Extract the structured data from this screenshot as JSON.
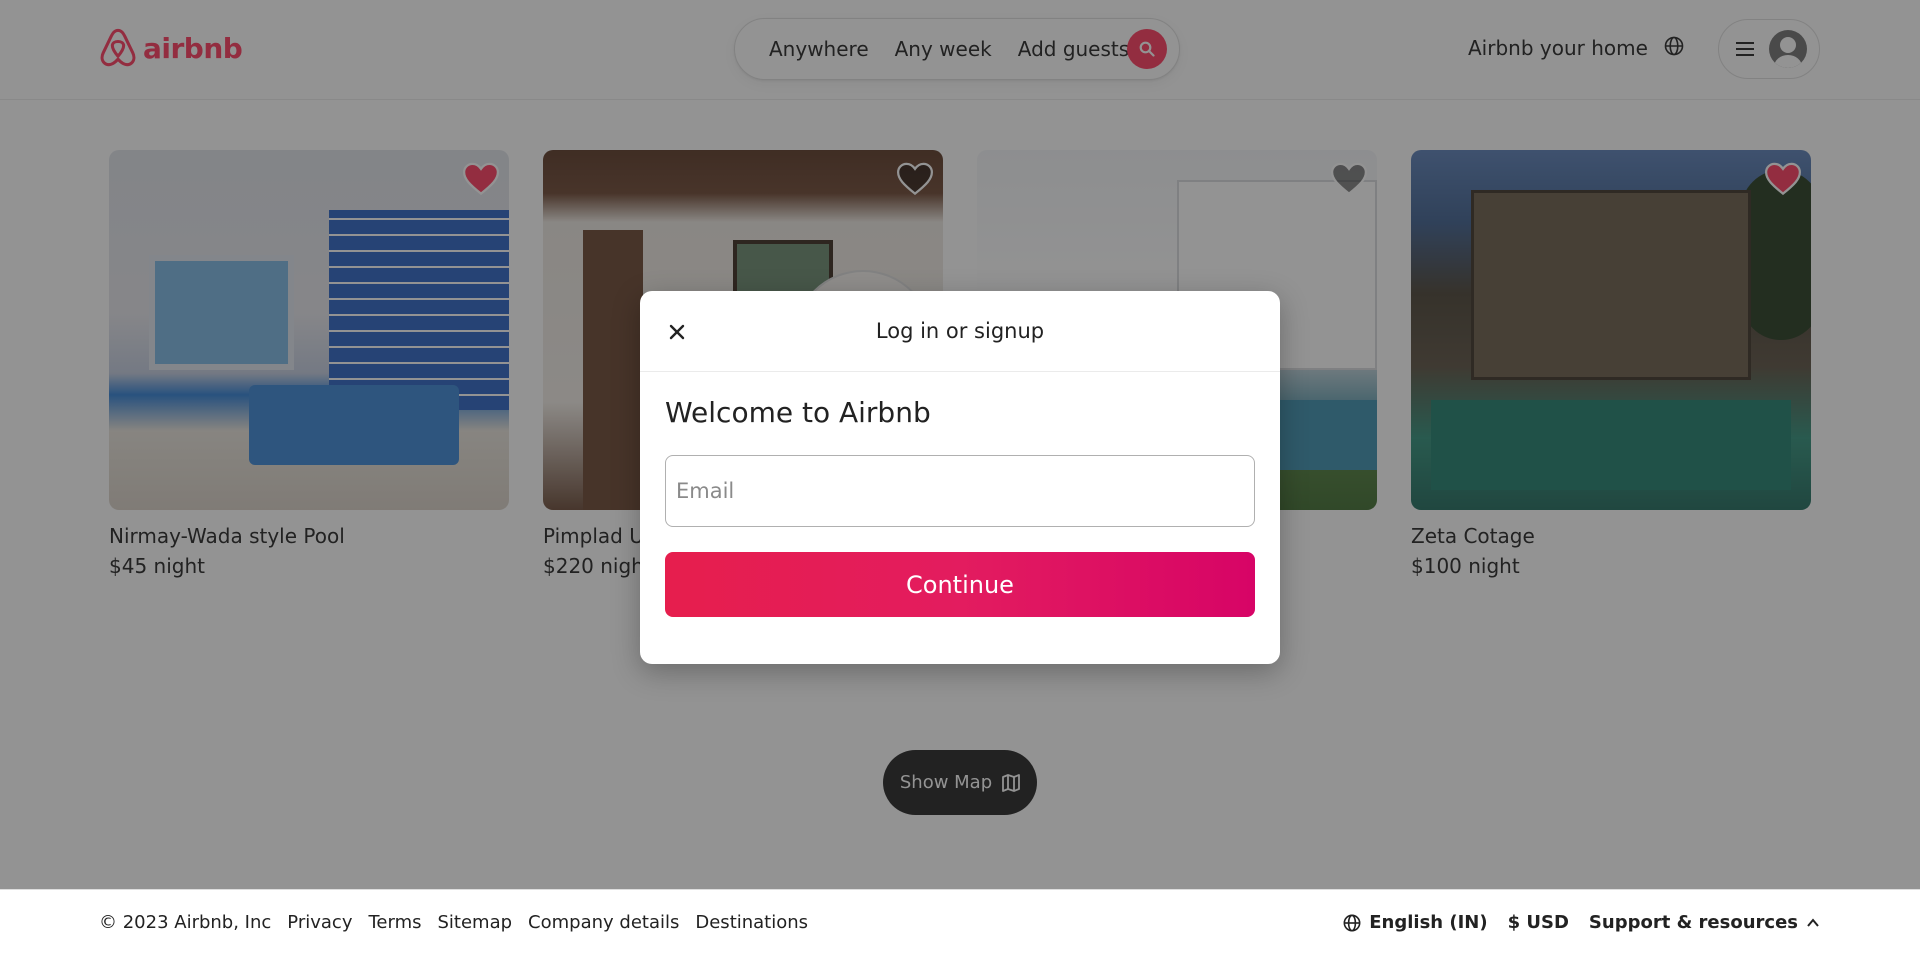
{
  "header": {
    "logo_text": "airbnb",
    "search": {
      "anywhere": "Anywhere",
      "any_week": "Any week",
      "add_guests": "Add guests"
    },
    "host_link": "Airbnb your home"
  },
  "listings": [
    {
      "title": "Nirmay-Wada style Pool",
      "price": "$45 night",
      "favorited": true
    },
    {
      "title": "Pimplad U",
      "price": "$220 nigh",
      "favorited": false
    },
    {
      "title": "",
      "price": "",
      "favorited": false
    },
    {
      "title": "Zeta Cotage",
      "price": "$100 night",
      "favorited": true
    }
  ],
  "show_map_label": "Show Map",
  "footer": {
    "copyright": "© 2023 Airbnb, Inc",
    "links": [
      "Privacy",
      "Terms",
      "Sitemap",
      "Company details",
      "Destinations"
    ],
    "language": "English (IN)",
    "currency": "$ USD",
    "support": "Support & resources"
  },
  "modal": {
    "title": "Log in or signup",
    "welcome": "Welcome to Airbnb",
    "email_placeholder": "Email",
    "email_value": "",
    "continue_label": "Continue"
  },
  "colors": {
    "brand": "#ff385c",
    "heart_favorited": "#ff385c",
    "heart_default": "rgba(0,0,0,0.5)",
    "continue_gradient_start": "#e61e4d",
    "continue_gradient_end": "#d70466"
  }
}
